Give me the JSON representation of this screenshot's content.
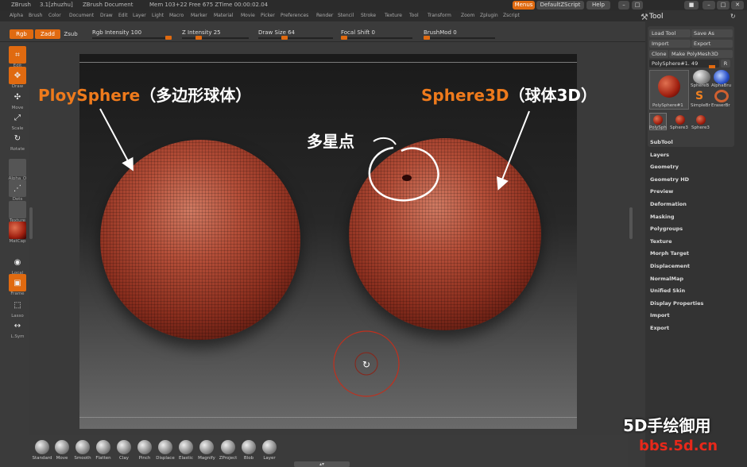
{
  "titlebar": {
    "app": "ZBrush",
    "version": "3.1[zhuzhu]",
    "document": "ZBrush Document",
    "mem": "Mem 103+22 Free 675 ZTime 00:00:02.04",
    "menus_btn": "Menus",
    "script_btn": "DefaultZScript",
    "help_btn": "Help"
  },
  "menu": [
    "Alpha",
    "Brush",
    "Color",
    "Document",
    "Draw",
    "Edit",
    "Layer",
    "Light",
    "Macro",
    "Marker",
    "Material",
    "Movie",
    "Picker",
    "Preferences",
    "Render",
    "Stencil",
    "Stroke",
    "Texture",
    "Tool",
    "Transform",
    "Zoom",
    "Zplugin",
    "Zscript"
  ],
  "topbar": {
    "rgb": "Rgb",
    "zadd": "Zadd",
    "zsub": "Zsub",
    "rgb_intensity": "Rgb Intensity 100",
    "z_intensity": "Z Intensity 25",
    "draw_size": "Draw Size 64",
    "focal_shift": "Focal Shift 0",
    "brushmod": "BrushMod 0"
  },
  "sliders": {
    "rgb_intensity": 1.0,
    "z_intensity": 0.25,
    "draw_size": 0.35,
    "focal_shift": 0.0,
    "brushmod": 0.0
  },
  "lefttools": [
    {
      "label": "Edit",
      "icon": "edit-icon"
    },
    {
      "label": "Draw",
      "icon": "draw-icon"
    },
    {
      "label": "Move",
      "icon": "move-icon"
    },
    {
      "label": "Scale",
      "icon": "scale-icon"
    },
    {
      "label": "Rotate",
      "icon": "rotate-icon"
    },
    {
      "label": "Alpha_O",
      "icon": "alpha-icon"
    },
    {
      "label": "Dots",
      "icon": "dots-icon"
    },
    {
      "label": "Texture",
      "icon": "texture-icon"
    },
    {
      "label": "MatCap",
      "icon": "matcap-icon"
    },
    {
      "label": "Local",
      "icon": "local-icon"
    },
    {
      "label": "Frame",
      "icon": "frame-icon"
    },
    {
      "label": "Lasso",
      "icon": "lasso-icon"
    },
    {
      "label": "L.Sym",
      "icon": "lsym-icon"
    }
  ],
  "annotations": {
    "left_en": "PloySphere",
    "left_cn": "（多边形球体）",
    "right_en": "Sphere3D",
    "right_cn": "（球体3D）",
    "pole": "多星点"
  },
  "brushes": [
    "Standard",
    "Move",
    "Smooth",
    "Flatten",
    "Clay",
    "Pinch",
    "Displace",
    "Elastic",
    "Magnify",
    "ZProject",
    "Blob",
    "Layer"
  ],
  "tool_panel": {
    "title": "Tool",
    "load_tool": "Load Tool",
    "save_as": "Save As",
    "import": "Import",
    "export": "Export",
    "clone": "Clone",
    "make_polymesh": "Make PolyMesh3D",
    "current": "PolySphere#1. 49",
    "r_btn": "R",
    "thumbs": {
      "main": "PolySphere#1",
      "t1": "SphereB",
      "t2": "AlphaBru",
      "t3": "SimpleBr",
      "t4": "EraserBr",
      "b1": "PolySph",
      "b2": "Sphere3",
      "b3": "Sphere3"
    },
    "items": [
      "SubTool",
      "Layers",
      "Geometry",
      "Geometry HD",
      "Preview",
      "Deformation",
      "Masking",
      "Polygroups",
      "Texture",
      "Morph Target",
      "Displacement",
      "NormalMap",
      "Unified Skin",
      "Display Properties",
      "Import",
      "Export"
    ]
  },
  "watermark": {
    "line1": "5D手绘御用",
    "line2": "bbs.5d.cn"
  },
  "colors": {
    "accent": "#e06a10",
    "annotation_en": "#ee7a1c",
    "watermark_red": "#e8281a"
  }
}
